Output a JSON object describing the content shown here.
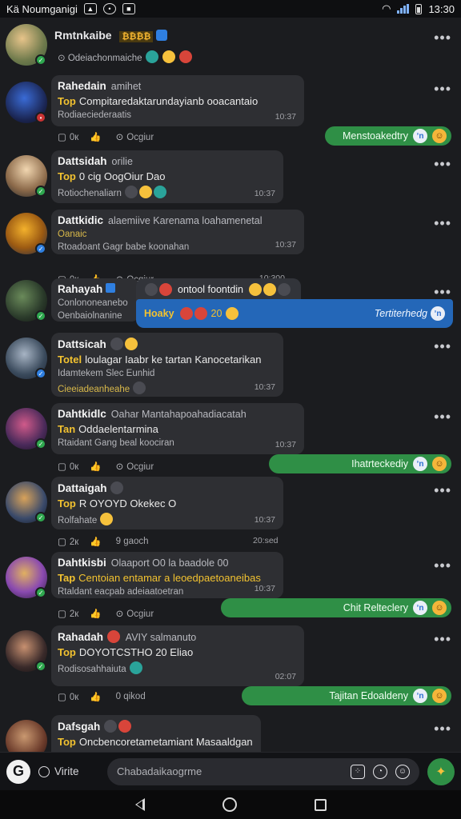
{
  "status_bar": {
    "carrier": "Kä Noumganigi",
    "time": "13:30"
  },
  "posts": [
    {
      "name": "Rmtnkaibe",
      "badge": "₿₿₿₿",
      "meta": "",
      "line": "",
      "sub": "Odeiachonmaiche",
      "link": "",
      "time": "",
      "actions": [],
      "reply": ""
    },
    {
      "name": "Rahedain",
      "badge": "",
      "meta": "amihet",
      "top": "Top",
      "line": "Compitaredaktarundayianb ooacantaio",
      "sub": "Rodiaeciederaatis",
      "link": "",
      "time": "10:37",
      "actions": [
        "0к",
        "Ocgiur"
      ],
      "reply": "Menstoakedtry"
    },
    {
      "name": "Dattsidah",
      "badge": "",
      "meta": "orilie",
      "top": "Top",
      "line": "0 cig OogOiur Dao",
      "sub": "Rotiochenaliarn",
      "link": "",
      "time": "10:37",
      "actions": [],
      "reply": ""
    },
    {
      "name": "Dattkidic",
      "badge": "",
      "meta": "alaemiive Karenama loahamenetal",
      "top": "",
      "line": "",
      "sub": "Rtoadoant Gagr babe koonahan",
      "link": "Oanaic",
      "time": "10:37",
      "actions": [
        "0к",
        "Ocgiur"
      ],
      "reply": "",
      "extra_time": "10:300"
    },
    {
      "name": "Rahayah",
      "badge": "",
      "meta": "",
      "top": "",
      "line": "",
      "sub": "Conlononeanebo",
      "sub2": "Oenbaiolnanine",
      "link": "",
      "time": "",
      "actions": [],
      "reply": "",
      "blue_top": "ontool foontdin",
      "blue_line": "Hoaky",
      "blue_num": "20",
      "blue_right": "Tertiterhedg"
    },
    {
      "name": "Dattsicah",
      "badge": "",
      "meta": "",
      "top": "Totel",
      "line": "loulagar Iaabr ke tartan Kanocetarikan",
      "sub": "Idamtekem Slec Eunhid",
      "link": "Cieeiadeanheahe",
      "time": "10:37",
      "actions": [],
      "reply": ""
    },
    {
      "name": "Dahtkidlc",
      "badge": "",
      "meta": "Oahar Mantahapoahadiacatah",
      "top": "Tan",
      "line": "Oddaelentarmina",
      "sub": "Rtaidant Gang beal koociran",
      "link": "",
      "time": "10:37",
      "actions": [
        "0к",
        "Ocgiur"
      ],
      "reply": "Ihatrteckediy"
    },
    {
      "name": "Dattaigah",
      "badge": "",
      "meta": "",
      "top": "Top",
      "line": "R OYOYD Okekec O",
      "sub": "Rolfahate",
      "link": "",
      "time": "10:37",
      "actions": [
        "2к",
        "9 gaoch"
      ],
      "reply": "",
      "extra_time": "20:sed"
    },
    {
      "name": "Dahtkisbi",
      "badge": "",
      "meta": "Olaaport O0 la baadole 00",
      "top": "Tap",
      "line": "Centoian entamar a leoedpaetoaneibas",
      "sub": "Rtaldant eacpab adeiaatoetran",
      "link": "",
      "time": "10:37",
      "actions": [
        "2к",
        "Ocgiur"
      ],
      "reply": "Chit Relteclery"
    },
    {
      "name": "Rahadah",
      "badge": "",
      "meta": "AVIY salmanuto",
      "top": "Top",
      "line": "DOYOTCSTHO 20 Eliao",
      "sub": "Rodisosahhaiuta",
      "link": "",
      "time": "02:07",
      "actions": [
        "0к",
        "0 qikod"
      ],
      "reply": "Tajitan Edoaldeny"
    },
    {
      "name": "Dafsgah",
      "badge": "",
      "meta": "",
      "top": "Top",
      "line": "Oncbencoretametamiant Masaaldgan",
      "sub": "",
      "link": "",
      "time": "",
      "actions": [],
      "reply": ""
    }
  ],
  "composer": {
    "write_label": "Virite",
    "placeholder": "Chabadaikaogrme"
  },
  "icons": [
    "g-logo-icon",
    "grid-icon",
    "gif-icon",
    "emoji-icon",
    "send-icon"
  ]
}
